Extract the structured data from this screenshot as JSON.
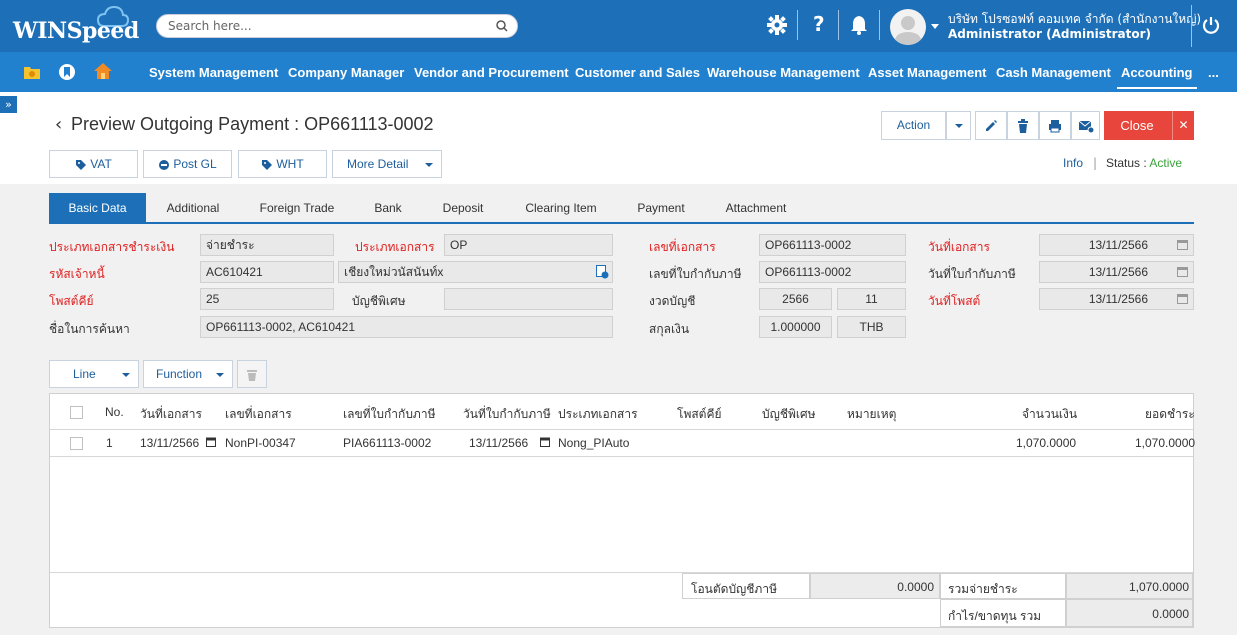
{
  "header": {
    "logo": "WINSpeed",
    "search_placeholder": "Search here...",
    "company": "บริษัท โปรซอฟท์ คอมเทค จำกัด (สำนักงานใหญ่)",
    "user": "Administrator (Administrator)"
  },
  "nav": {
    "items": [
      "System Management",
      "Company Manager",
      "Vendor and Procurement",
      "Customer and Sales",
      "Warehouse Management",
      "Asset Management",
      "Cash Management",
      "Accounting"
    ],
    "more": "..."
  },
  "page": {
    "title": "Preview Outgoing Payment : OP661113-0002",
    "buttons": {
      "vat": "VAT",
      "post_gl": "Post GL",
      "wht": "WHT",
      "more_detail": "More Detail",
      "action": "Action",
      "close": "Close"
    },
    "info": "Info",
    "status_label": "Status",
    "status_sep": ":",
    "status_value": "Active"
  },
  "tabs": [
    "Basic Data",
    "Additional",
    "Foreign Trade",
    "Bank",
    "Deposit",
    "Clearing Item",
    "Payment",
    "Attachment"
  ],
  "form": {
    "doc_pay_type_label": "ประเภทเอกสารชำระเงิน",
    "doc_pay_type": "จ่ายชำระ",
    "doc_type_label": "ประเภทเอกสาร",
    "doc_type": "OP",
    "doc_no_label": "เลขที่เอกสาร",
    "doc_no": "OP661113-0002",
    "doc_date_label": "วันที่เอกสาร",
    "doc_date": "13/11/2566",
    "creditor_label": "รหัสเจ้าหนี้",
    "creditor_code": "AC610421",
    "creditor_name": "เชียงใหม่วนัสนันท์x",
    "tax_no_label": "เลขที่ใบกำกับภาษี",
    "tax_no": "OP661113-0002",
    "tax_date_label": "วันที่ใบกำกับภาษี",
    "tax_date": "13/11/2566",
    "project_label": "โพสต์คีย์",
    "project": "25",
    "special_acc_label": "บัญชีพิเศษ",
    "special_acc": "",
    "period_label": "งวดบัญชี",
    "period_year": "2566",
    "period_month": "11",
    "post_date_label": "วันที่โพสต์",
    "post_date": "13/11/2566",
    "search_name_label": "ชื่อในการค้นหา",
    "search_name": "OP661113-0002, AC610421",
    "currency_label": "สกุลเงิน",
    "rate": "1.000000",
    "currency": "THB"
  },
  "grid": {
    "line_btn": "Line",
    "function_btn": "Function",
    "headers": [
      "No.",
      "วันที่เอกสาร",
      "เลขที่เอกสาร",
      "เลขที่ใบกำกับภาษี",
      "วันที่ใบกำกับภาษี",
      "ประเภทเอกสาร",
      "โพสต์คีย์",
      "บัญชีพิเศษ",
      "หมายเหตุ",
      "จำนวนเงิน",
      "ยอดชำระ"
    ],
    "rows": [
      {
        "no": "1",
        "doc_date": "13/11/2566",
        "doc_no": "NonPI-00347",
        "tax_no": "PIA661113-0002",
        "tax_date": "13/11/2566",
        "doc_type": "Nong_PIAuto",
        "amount": "1,070.0000",
        "paid": "1,070.0000"
      }
    ]
  },
  "footer": {
    "transfer_label": "โอนตัดบัญชีภาษี",
    "transfer_value": "0.0000",
    "total_label": "รวมจ่ายชำระ",
    "total_value": "1,070.0000",
    "gain_label": "กำไร/ขาดทุน รวม",
    "gain_value": "0.0000"
  }
}
